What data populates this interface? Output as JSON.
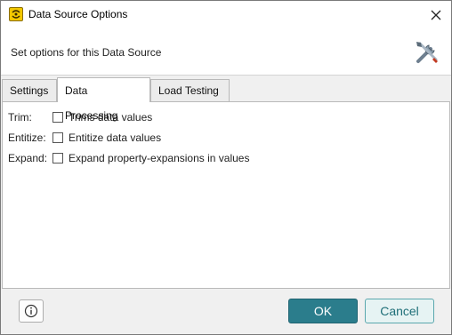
{
  "window": {
    "title": "Data Source Options",
    "app_icon": "soapui-icon",
    "close_icon": "close-icon"
  },
  "header": {
    "description": "Set options for this Data Source",
    "icon": "tools-icon"
  },
  "tabs": [
    {
      "label": "Settings",
      "active": false
    },
    {
      "label": "Data Processing",
      "active": true
    },
    {
      "label": "Load Testing",
      "active": false
    }
  ],
  "options": [
    {
      "label": "Trim:",
      "text": "Trims data values",
      "checked": false
    },
    {
      "label": "Entitize:",
      "text": "Entitize data values",
      "checked": false
    },
    {
      "label": "Expand:",
      "text": "Expand property-expansions in values",
      "checked": false
    }
  ],
  "footer": {
    "info_icon": "info-icon",
    "ok_label": "OK",
    "cancel_label": "Cancel"
  },
  "colors": {
    "ok_background": "#2b7d8c",
    "cancel_background": "#e6f3f3",
    "cancel_text": "#1f6f78"
  }
}
